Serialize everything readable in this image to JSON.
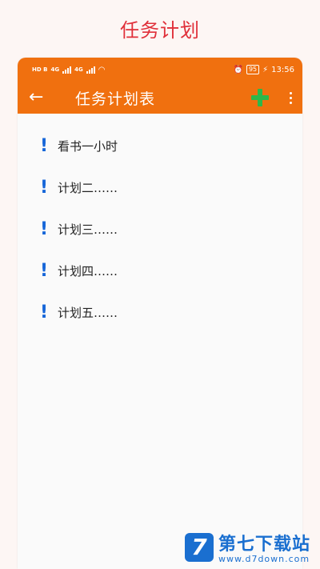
{
  "promo": {
    "title": "任务计划"
  },
  "status_bar": {
    "sim1": "HD B",
    "sim2": "HD B",
    "net1": "4G",
    "net2": "4G",
    "alarm_icon": "alarm-icon",
    "battery": "95",
    "charging_icon": "bolt-icon",
    "time": "13:56"
  },
  "app_bar": {
    "title": "任务计划表",
    "back_icon": "arrow-left-icon",
    "add_icon": "plus-icon",
    "more_icon": "more-vertical-icon",
    "add_color": "#2db84a",
    "bar_color": "#f0700f"
  },
  "tasks": [
    {
      "label": "看书一小时"
    },
    {
      "label": "计划二……"
    },
    {
      "label": "计划三……"
    },
    {
      "label": "计划四……"
    },
    {
      "label": "计划五……"
    }
  ],
  "priority_color": "#1565d8",
  "watermark": {
    "name": "第七下载站",
    "url": "www.d7down.com",
    "logo": "7"
  }
}
